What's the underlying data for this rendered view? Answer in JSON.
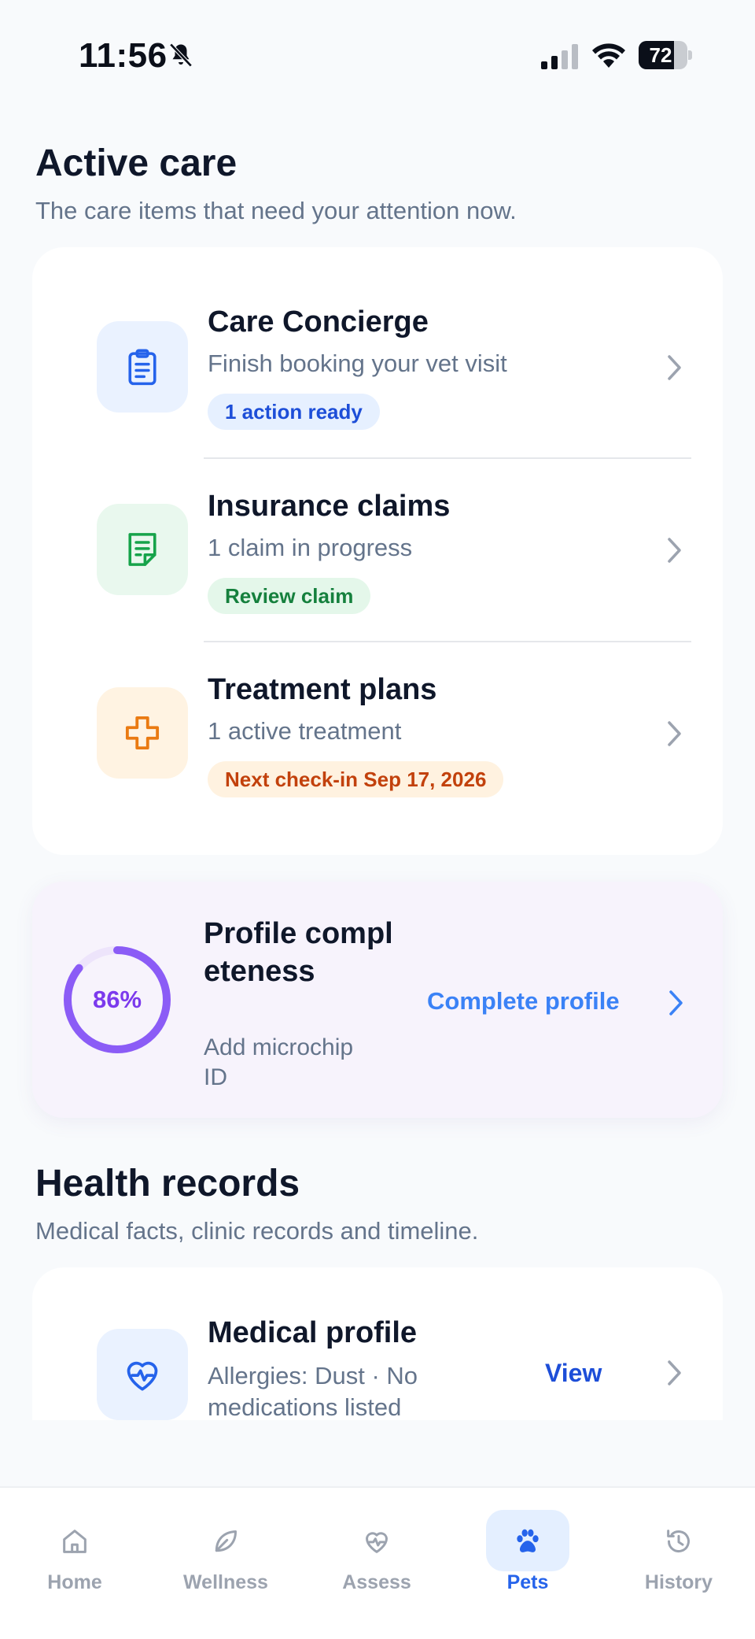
{
  "status_bar": {
    "time": "11:56",
    "battery": "72",
    "battery_level": 0.72
  },
  "active_care": {
    "title": "Active care",
    "subtitle": "The care items that need your attention now.",
    "items": [
      {
        "title": "Care Concierge",
        "subtitle": "Finish booking your vet visit",
        "badge": "1 action ready",
        "icon": "clipboard-icon",
        "badge_color": "#1d4ed8",
        "badge_bg": "#e6f0ff",
        "tile_bg": "#eaf2ff"
      },
      {
        "title": "Insurance claims",
        "subtitle": "1 claim in progress",
        "badge": "Review claim",
        "icon": "claim-document-icon",
        "badge_color": "#15803d",
        "badge_bg": "#e4f7ea",
        "tile_bg": "#e9f8ee"
      },
      {
        "title": "Treatment plans",
        "subtitle": "1 active treatment",
        "badge": "Next check-in Sep 17, 2026",
        "icon": "medical-cross-icon",
        "badge_color": "#c2410c",
        "badge_bg": "#fff2e0",
        "tile_bg": "#fff3e2"
      }
    ]
  },
  "profile": {
    "percent_label": "86%",
    "percent": 86,
    "title": "Profile completeness",
    "subtitle": "Add microchip ID",
    "action": "Complete profile",
    "accent": "#8b5cf6"
  },
  "health_records": {
    "title": "Health records",
    "subtitle": "Medical facts, clinic records and timeline.",
    "medical_profile": {
      "title": "Medical profile",
      "subtitle": "Allergies: Dust · No medications listed",
      "action": "View",
      "icon": "heart-pulse-icon"
    }
  },
  "tabs": [
    {
      "label": "Home",
      "icon": "home-icon",
      "active": false
    },
    {
      "label": "Wellness",
      "icon": "leaf-icon",
      "active": false
    },
    {
      "label": "Assess",
      "icon": "heart-pulse-icon",
      "active": false
    },
    {
      "label": "Pets",
      "icon": "paw-icon",
      "active": true
    },
    {
      "label": "History",
      "icon": "history-icon",
      "active": false
    }
  ]
}
